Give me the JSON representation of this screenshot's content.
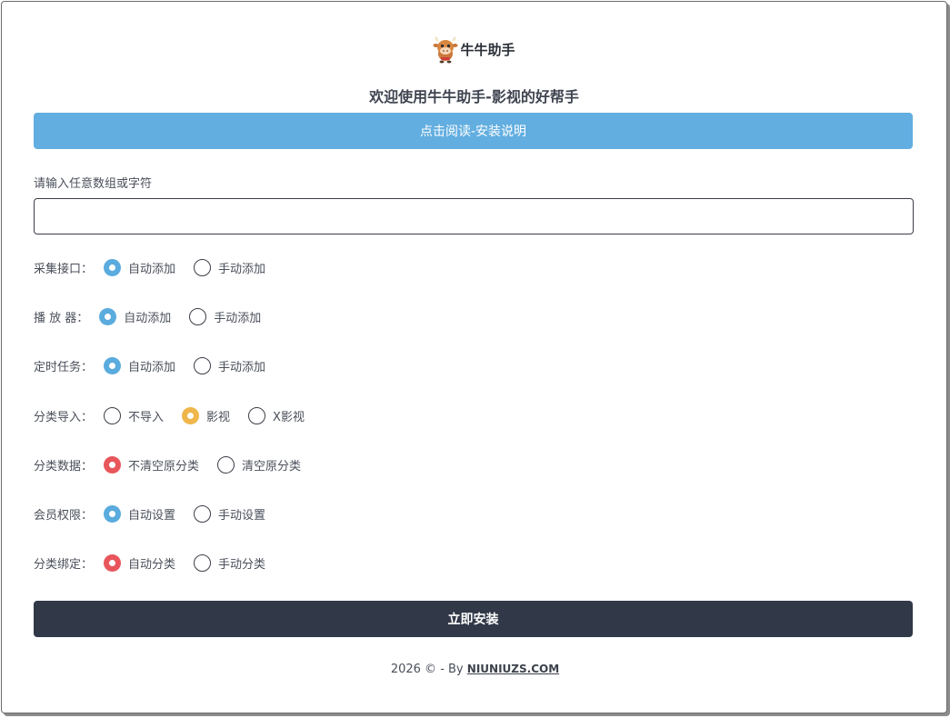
{
  "header": {
    "logo_text": "牛牛助手",
    "title": "欢迎使用牛牛助手-影视的好帮手"
  },
  "guide_button_label": "点击阅读-安装说明",
  "input": {
    "label": "请输入任意数组或字符",
    "value": "",
    "placeholder": ""
  },
  "options": [
    {
      "label": "采集接口：",
      "choices": [
        "自动添加",
        "手动添加"
      ],
      "selected": 0,
      "color": "#5aabde"
    },
    {
      "label": "播 放 器：",
      "choices": [
        "自动添加",
        "手动添加"
      ],
      "selected": 0,
      "color": "#5aabde"
    },
    {
      "label": "定时任务：",
      "choices": [
        "自动添加",
        "手动添加"
      ],
      "selected": 0,
      "color": "#5aabde"
    },
    {
      "label": "分类导入：",
      "choices": [
        "不导入",
        "影视",
        "X影视"
      ],
      "selected": 1,
      "color": "#efb64a"
    },
    {
      "label": "分类数据：",
      "choices": [
        "不清空原分类",
        "清空原分类"
      ],
      "selected": 0,
      "color": "#e8565b"
    },
    {
      "label": "会员权限：",
      "choices": [
        "自动设置",
        "手动设置"
      ],
      "selected": 0,
      "color": "#5aabde"
    },
    {
      "label": "分类绑定：",
      "choices": [
        "自动分类",
        "手动分类"
      ],
      "selected": 0,
      "color": "#e8565b"
    }
  ],
  "install_button_label": "立即安装",
  "footer": {
    "text": "2026 © - By",
    "link": "NIUNIUZS.COM"
  },
  "icons": {
    "logo": "cow-mascot-icon"
  }
}
